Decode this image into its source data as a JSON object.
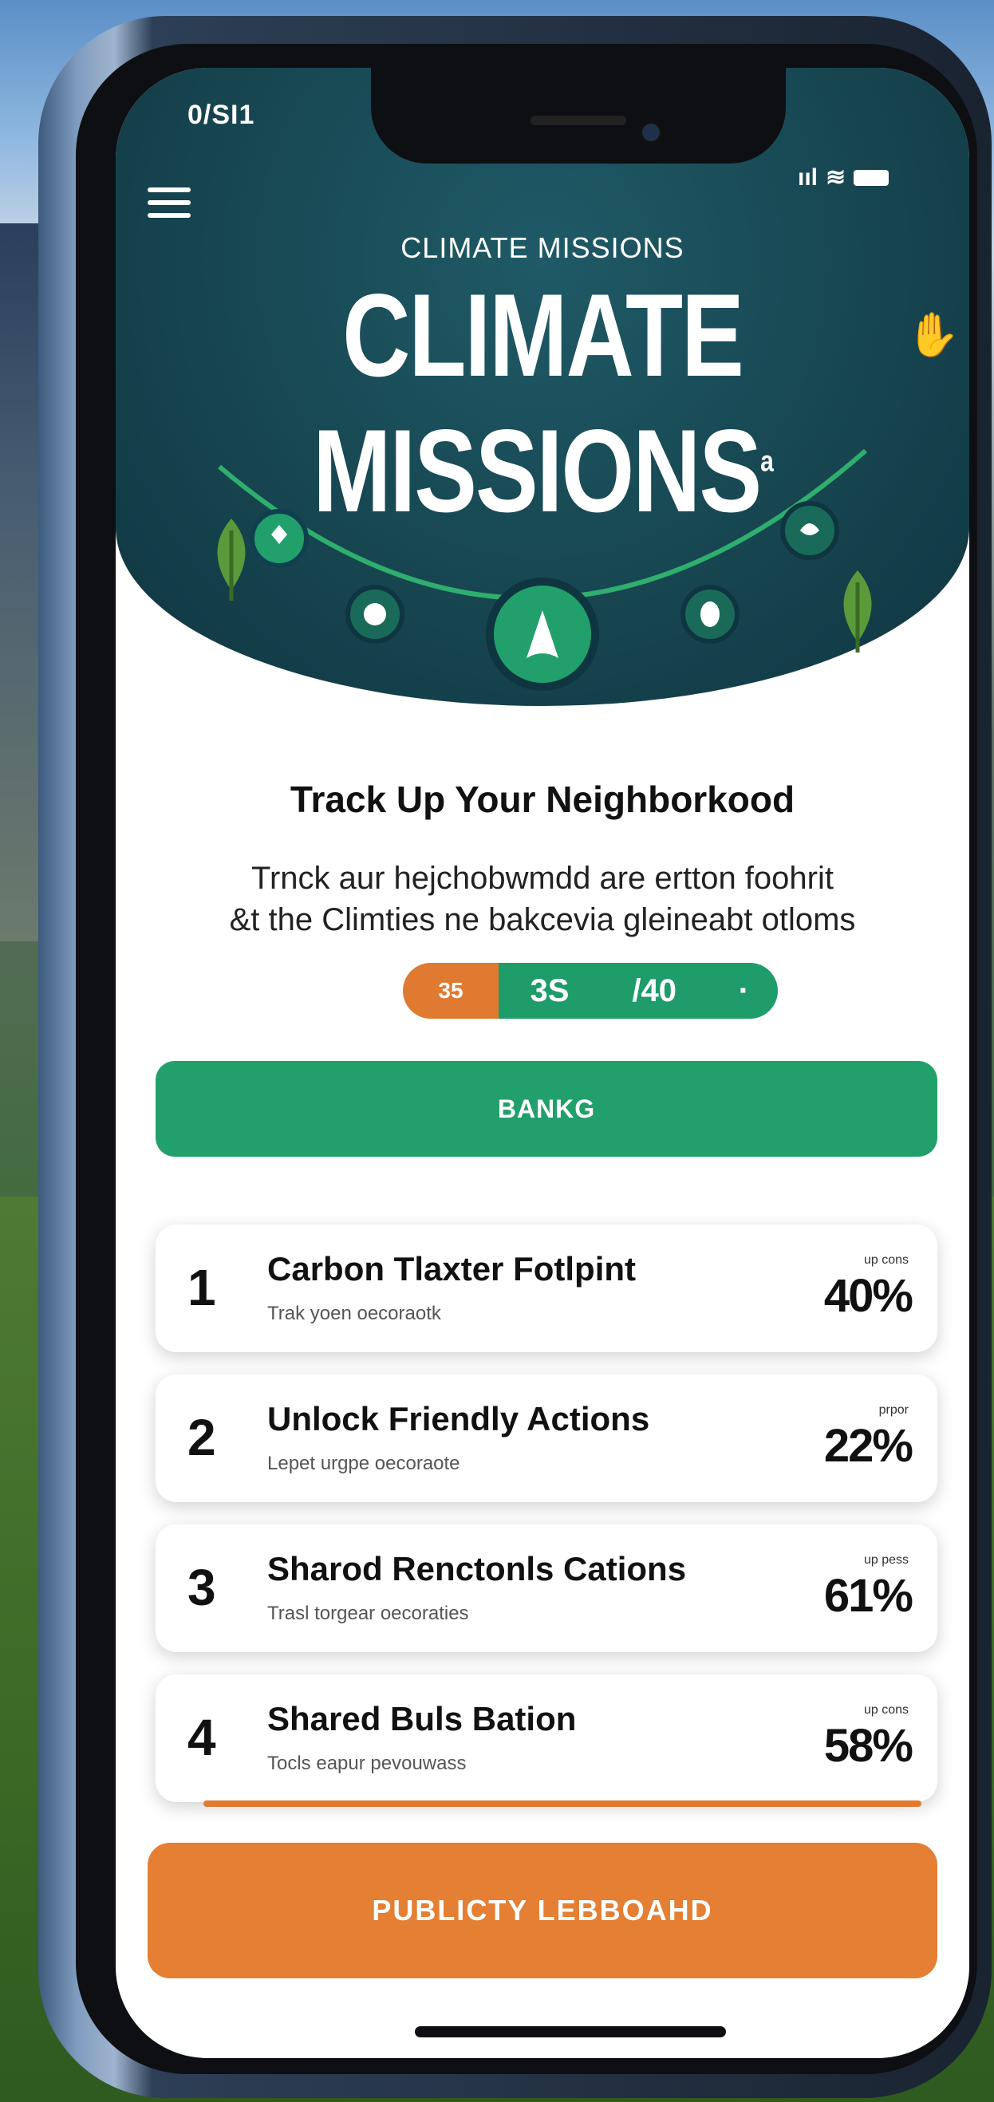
{
  "status_bar": {
    "time": "0/SI1",
    "signal": "ııl"
  },
  "header": {
    "small_title": "CLIMATE MISSIONS",
    "big_title": "CLIMATE MISSIONS",
    "trademark": "a"
  },
  "intro": {
    "headline": "Track Up Your Neighborkood",
    "subtitle_line1": "Trnck aur hejchobwmdd are ertton foohrit",
    "subtitle_line2": "&t the Climties ne bakcevia gleineabt otloms"
  },
  "score_pill": {
    "first": "35",
    "second": "3S",
    "third": "/40",
    "fourth": "▪"
  },
  "banner_button": {
    "label": "BANKG"
  },
  "missions": [
    {
      "rank": "1",
      "title": "Carbon Tlaxter Fotlpint",
      "desc": "Trak yoen oecoraotk",
      "pct_label": "up cons",
      "pct": "40%"
    },
    {
      "rank": "2",
      "title": "Unlock Friendly Actions",
      "desc": "Lepet urgpe oecoraote",
      "pct_label": "prpor",
      "pct": "22%"
    },
    {
      "rank": "3",
      "title": "Sharod Renctonls Cations",
      "desc": "Trasl torgear oecoraties",
      "pct_label": "up pess",
      "pct": "61%"
    },
    {
      "rank": "4",
      "title": "Shared Buls Bation",
      "desc": "Tocls eapur pevouwass",
      "pct_label": "up cons",
      "pct": "58%"
    }
  ],
  "leaderboard_button": {
    "label": "PUBLICTY LEBBOAHD"
  },
  "colors": {
    "teal": "#16444f",
    "green": "#22a06b",
    "orange": "#e57f34"
  }
}
